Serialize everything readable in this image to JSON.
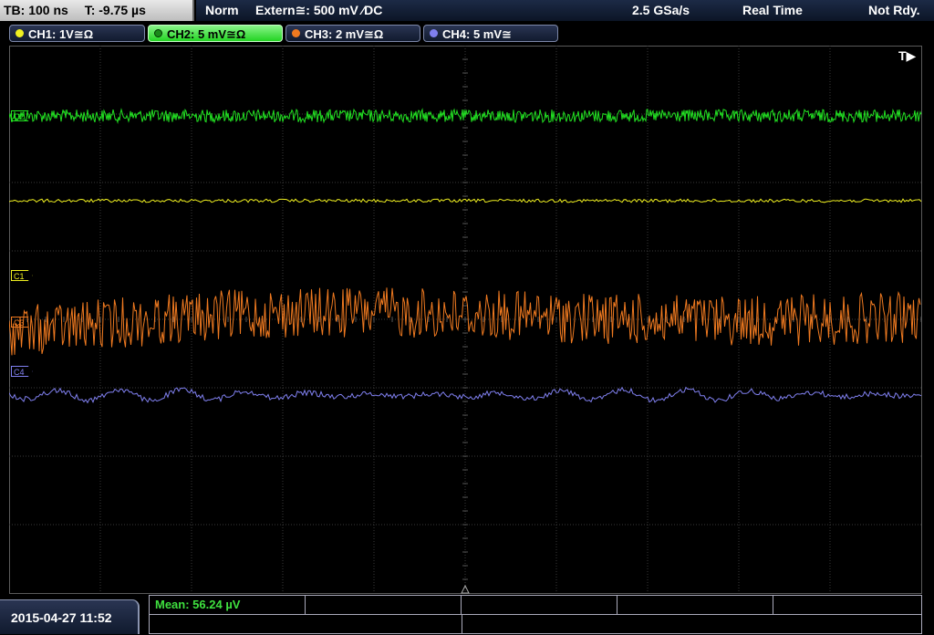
{
  "top_bar": {
    "timebase": "TB: 100 ns",
    "trigger_time": "T: -9.75 µs",
    "acq_mode": "Norm",
    "trigger_source": "Extern≅: 500 mV ⁄DC",
    "sample_rate": "2.5 GSa/s",
    "acq_type": "Real Time",
    "status": "Not Rdy."
  },
  "channels": [
    {
      "label": "CH1: 1V≅Ω",
      "color": "#f0f020",
      "active": false
    },
    {
      "label": "CH2: 5 mV≅Ω",
      "color": "#22e022",
      "active": true
    },
    {
      "label": "CH3: 2 mV≅Ω",
      "color": "#f07a20",
      "active": false
    },
    {
      "label": "CH4: 5 mV≅",
      "color": "#8080f0",
      "active": false
    }
  ],
  "channel_markers": {
    "c1": "C1",
    "c2": "C2",
    "c3": "C3",
    "c4": "C4"
  },
  "trigger_label": "T▶",
  "footer": {
    "datetime": "2015-04-27 11:52",
    "measurement": "Mean: 56.24 µV"
  },
  "colors": {
    "ch1": "#f0f020",
    "ch2": "#22e022",
    "ch3": "#f07a20",
    "ch4": "#8080f0",
    "grid": "#3a3a3a"
  }
}
